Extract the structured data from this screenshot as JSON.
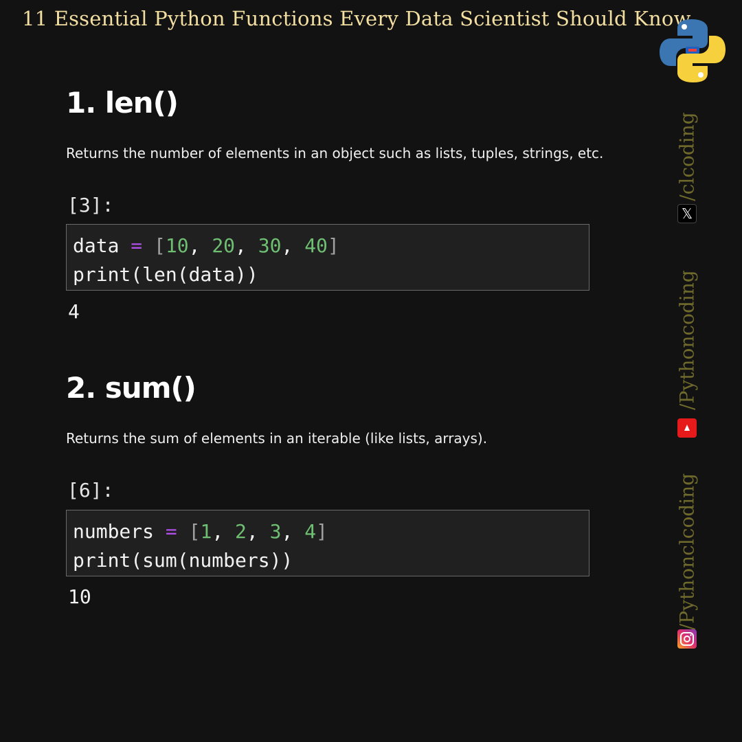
{
  "header": {
    "title": "11 Essential Python Functions Every Data Scientist Should Know"
  },
  "sections": [
    {
      "heading": "1. len()",
      "description": "Returns the number of elements in an object such as lists, tuples, strings, etc.",
      "cell": {
        "prompt": "[3]:",
        "line1": {
          "var": "data",
          "op": "=",
          "open": "[",
          "n1": "10",
          "n2": "20",
          "n3": "30",
          "n4": "40",
          "close": "]"
        },
        "line2": "print(len(data))",
        "output": "4"
      }
    },
    {
      "heading": "2. sum()",
      "description": "Returns the sum of elements in an iterable (like lists, arrays).",
      "cell": {
        "prompt": "[6]:",
        "line1": {
          "var": "numbers",
          "op": "=",
          "open": "[",
          "n1": "1",
          "n2": "2",
          "n3": "3",
          "n4": "4",
          "close": "]"
        },
        "line2": "print(sum(numbers))",
        "output": "10"
      }
    }
  ],
  "sidebar": {
    "handles": [
      "/clcoding",
      "/Pythoncoding",
      "/Pythonclcoding"
    ],
    "icons": [
      "x-icon",
      "youtube-icon",
      "instagram-icon"
    ],
    "x_glyph": "𝕏"
  },
  "colors": {
    "background": "#121212",
    "title": "#f3dfa2",
    "handle": "#6f6a2c",
    "code_bg": "#202020",
    "operator": "#b04fe8",
    "number": "#6fbf73"
  }
}
